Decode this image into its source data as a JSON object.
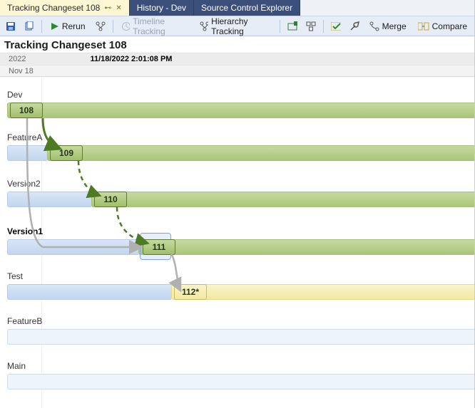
{
  "chart_data": {
    "type": "diagram",
    "title": "Tracking Changeset 108",
    "timestamp_label": "11/18/2022 2:01:08 PM",
    "branches": [
      "Dev",
      "FeatureA",
      "Version2",
      "Version1",
      "Test",
      "FeatureB",
      "Main"
    ],
    "changesets": [
      {
        "branch": "Dev",
        "id": "108",
        "status": "merged"
      },
      {
        "branch": "FeatureA",
        "id": "109",
        "status": "merged"
      },
      {
        "branch": "Version2",
        "id": "110",
        "status": "partial"
      },
      {
        "branch": "Version1",
        "id": "111",
        "status": "merged"
      },
      {
        "branch": "Test",
        "id": "112*",
        "status": "pending"
      }
    ],
    "merges": [
      {
        "from": "108",
        "to": "109",
        "kind": "direct"
      },
      {
        "from": "109",
        "to": "110",
        "kind": "baseless"
      },
      {
        "from": "110",
        "to": "111",
        "kind": "baseless"
      },
      {
        "from": "108",
        "to": "111",
        "kind": "indirect"
      },
      {
        "from": "111",
        "to": "112*",
        "kind": "indirect"
      }
    ],
    "selected_branch": "Version1"
  },
  "tabs": {
    "active": {
      "label": "Tracking Changeset 108"
    },
    "history": {
      "label": "History - Dev"
    },
    "sce": {
      "label": "Source Control Explorer"
    }
  },
  "toolbar": {
    "rerun": "Rerun",
    "timeline_tracking": "Timeline Tracking",
    "hierarchy_tracking": "Hierarchy Tracking",
    "merge": "Merge",
    "compare": "Compare"
  },
  "title": "Tracking Changeset 108",
  "timehdr": {
    "year": "2022",
    "timestamp": "11/18/2022 2:01:08 PM",
    "day": "Nov 18"
  },
  "branches": {
    "dev": {
      "label": "Dev",
      "bold": false
    },
    "featureA": {
      "label": "FeatureA",
      "bold": false
    },
    "version2": {
      "label": "Version2",
      "bold": false
    },
    "version1": {
      "label": "Version1",
      "bold": true
    },
    "test": {
      "label": "Test",
      "bold": false
    },
    "featureB": {
      "label": "FeatureB",
      "bold": false
    },
    "main": {
      "label": "Main",
      "bold": false
    }
  },
  "changesets": {
    "c108": "108",
    "c109": "109",
    "c110": "110",
    "c111": "111",
    "c112": "112*"
  },
  "colors": {
    "accent": "#3b4f7a",
    "mergeSolid": "#4f7a23",
    "mergeGhost": "#b9b9b9"
  }
}
